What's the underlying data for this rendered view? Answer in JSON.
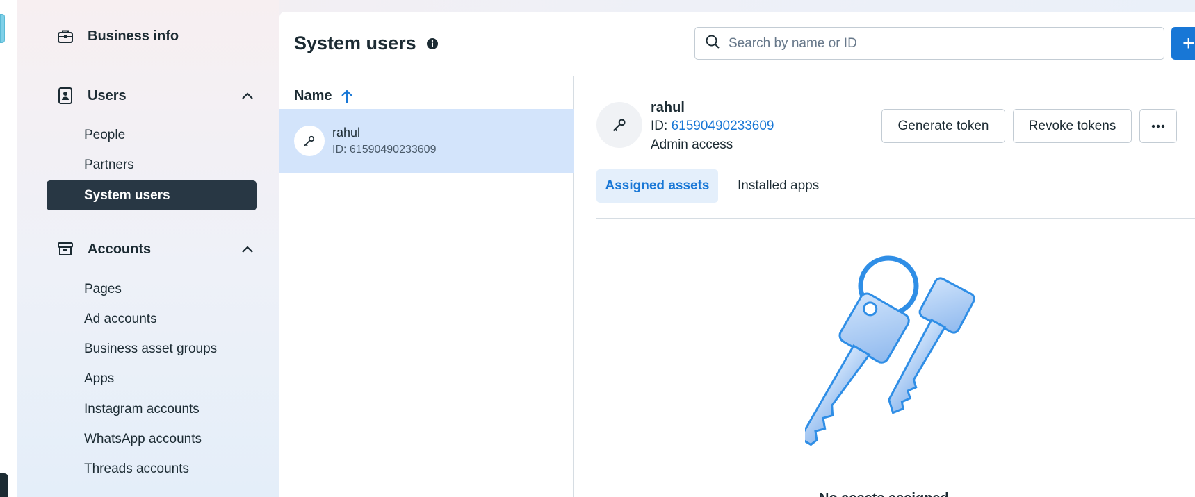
{
  "sidebar": {
    "business_info": "Business info",
    "users_section": "Users",
    "users_items": [
      "People",
      "Partners",
      "System users"
    ],
    "accounts_section": "Accounts",
    "accounts_items": [
      "Pages",
      "Ad accounts",
      "Business asset groups",
      "Apps",
      "Instagram accounts",
      "WhatsApp accounts",
      "Threads accounts"
    ]
  },
  "header": {
    "title": "System users",
    "search_placeholder": "Search by name or ID",
    "add_label": "+"
  },
  "list": {
    "column_name": "Name",
    "users": [
      {
        "name": "rahul",
        "id_text": "ID: 61590490233609"
      }
    ]
  },
  "detail": {
    "name": "rahul",
    "id_prefix": "ID: ",
    "id_value": "61590490233609",
    "access": "Admin access",
    "generate_token": "Generate token",
    "revoke_tokens": "Revoke tokens",
    "more": "···",
    "tabs": [
      "Assigned assets",
      "Installed apps"
    ],
    "empty_message": "No assets assigned"
  },
  "colors": {
    "accent": "#1877d6",
    "active_nav": "#283744",
    "selected_row": "#d3e4fb"
  }
}
